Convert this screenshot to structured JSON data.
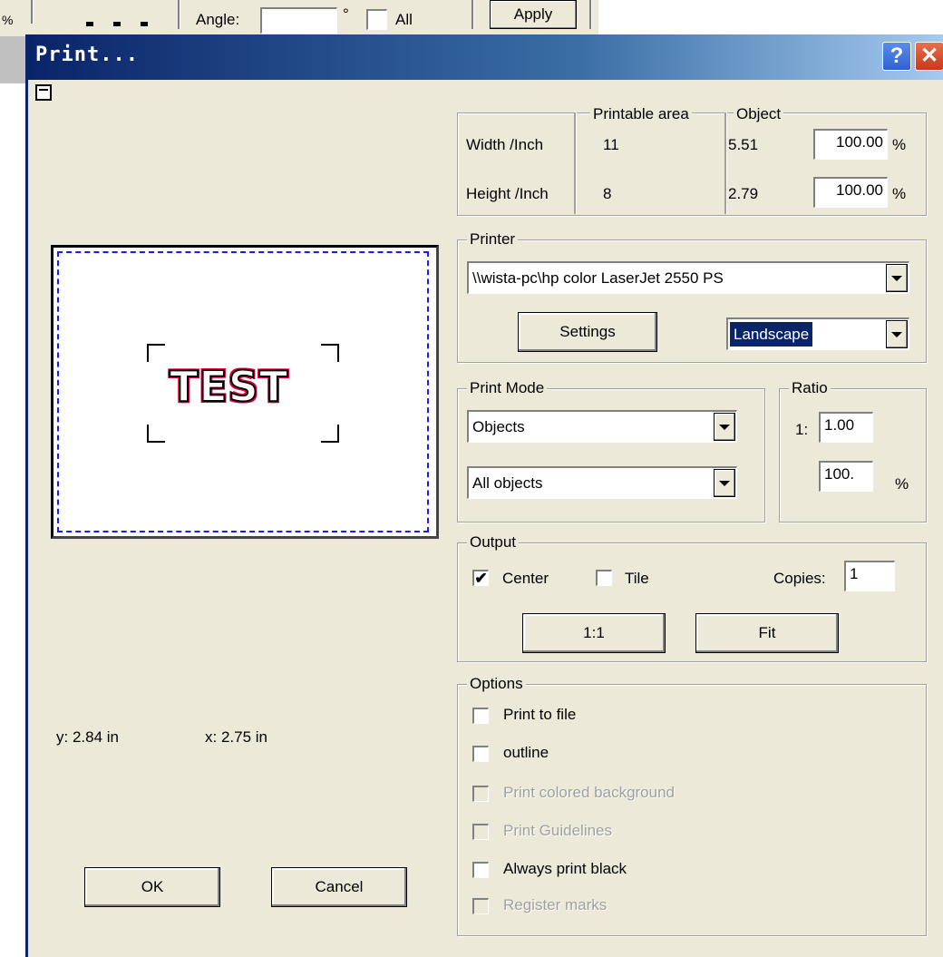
{
  "background_app": {
    "percent_symbol": "%",
    "angle_label": "Angle:",
    "angle_value": "",
    "degree_symbol": "°",
    "all_label": "All",
    "apply_label": "Apply"
  },
  "dialog": {
    "title": "Print...",
    "help_label": "?",
    "close_label": "✕"
  },
  "dimensions": {
    "printable_area_header": "Printable area",
    "object_header": "Object",
    "rows": [
      {
        "label": "Width /Inch",
        "printable": "11",
        "object": "5.51",
        "percent": "100.00",
        "unit": "%"
      },
      {
        "label": "Height /Inch",
        "printable": "8",
        "object": "2.79",
        "percent": "100.00",
        "unit": "%"
      }
    ]
  },
  "printer": {
    "group_label": "Printer",
    "selected_printer": "\\\\wista-pc\\hp color LaserJet 2550 PS",
    "settings_label": "Settings",
    "orientation": "Landscape"
  },
  "print_mode": {
    "group_label": "Print Mode",
    "mode": "Objects",
    "scope": "All objects"
  },
  "ratio": {
    "group_label": "Ratio",
    "prefix": "1:",
    "value": "1.00",
    "percent_value": "100.",
    "percent_unit": "%"
  },
  "output": {
    "group_label": "Output",
    "center_label": "Center",
    "center_checked": true,
    "tile_label": "Tile",
    "tile_checked": false,
    "copies_label": "Copies:",
    "copies_value": "1",
    "one_to_one_label": "1:1",
    "fit_label": "Fit"
  },
  "options": {
    "group_label": "Options",
    "items": [
      {
        "label": "Print to file",
        "checked": false,
        "enabled": true
      },
      {
        "label": "outline",
        "checked": false,
        "enabled": true
      },
      {
        "label": "Print colored background",
        "checked": false,
        "enabled": false
      },
      {
        "label": "Print Guidelines",
        "checked": false,
        "enabled": false
      },
      {
        "label": "Always print black",
        "checked": false,
        "enabled": true
      },
      {
        "label": "Register marks",
        "checked": false,
        "enabled": false
      }
    ]
  },
  "preview": {
    "text": "TEST",
    "y_readout": "y: 2.84 in",
    "x_readout": "x: 2.75 in"
  },
  "footer": {
    "ok_label": "OK",
    "cancel_label": "Cancel"
  },
  "colors": {
    "title_bar": "#0a246a",
    "dialog_bg": "#ece9d8",
    "selection": "#0a246a",
    "preview_outline": "#e0003a",
    "preview_border": "#1a1aff"
  }
}
